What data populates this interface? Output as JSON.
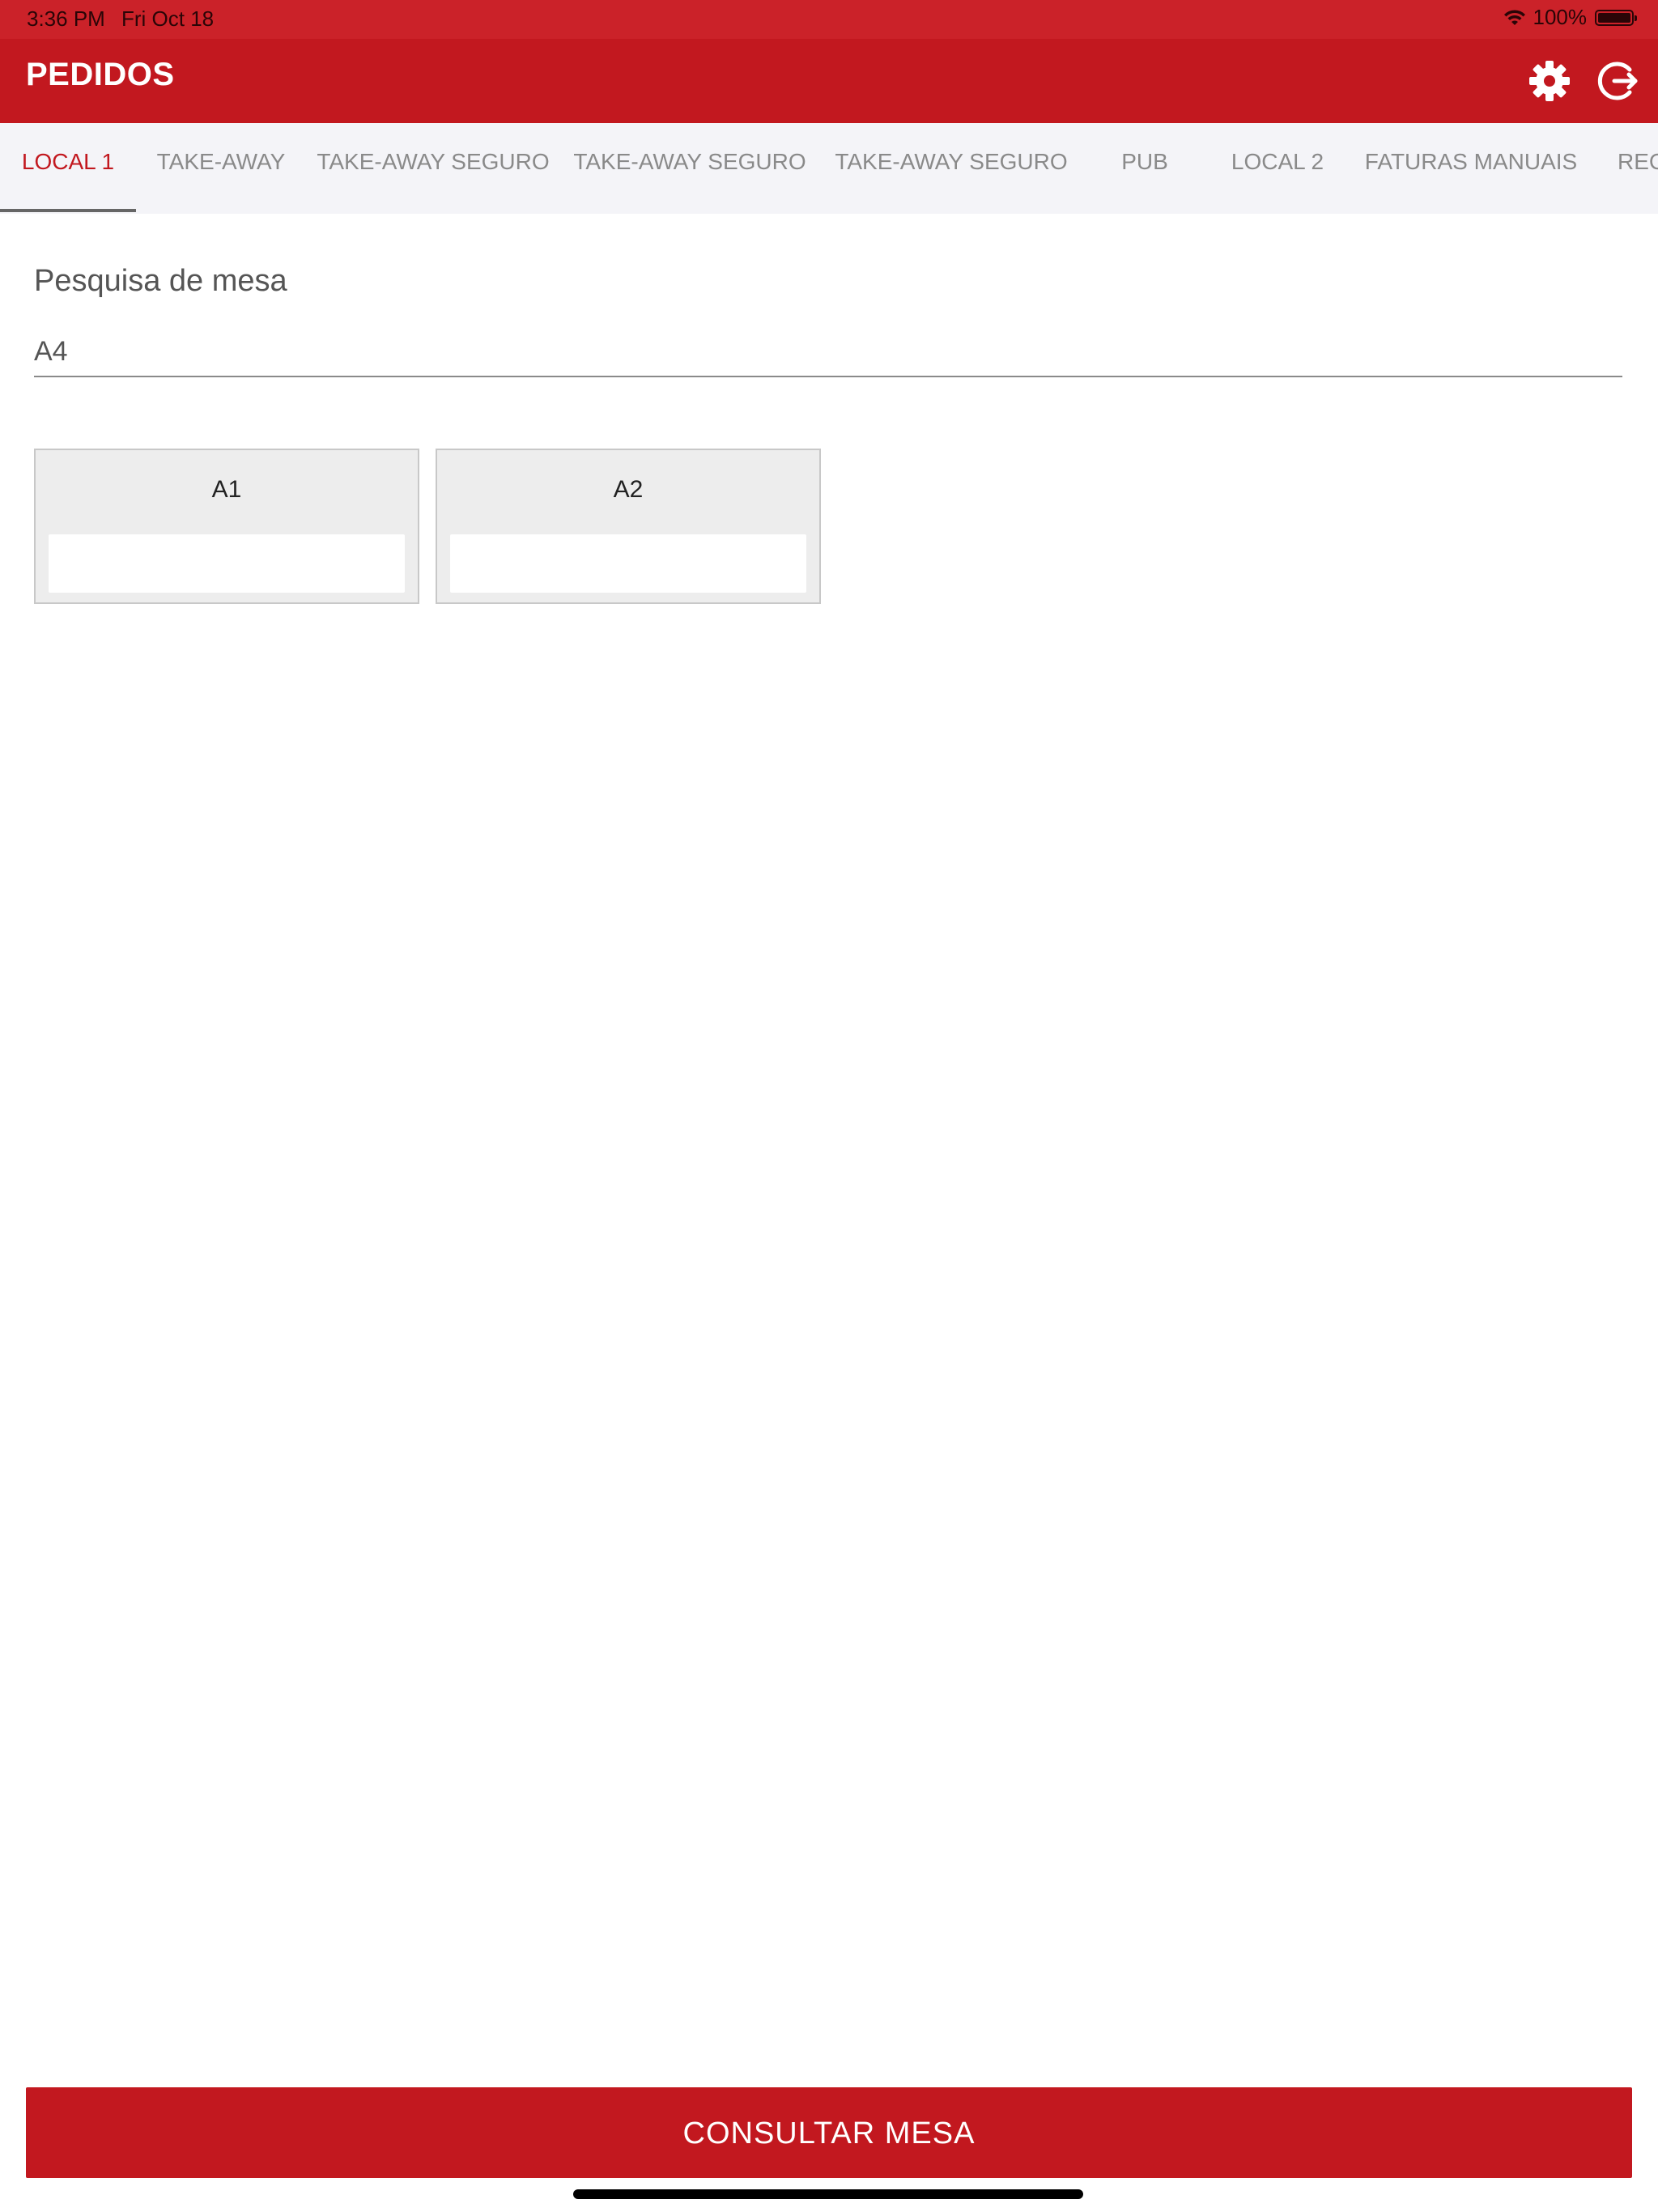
{
  "status_bar": {
    "time": "3:36 PM",
    "date": "Fri Oct 18",
    "battery_percent": "100%",
    "battery_level": 1.0,
    "wifi_icon": "wifi-icon"
  },
  "header": {
    "title": "PEDIDOS",
    "settings_icon": "gear-icon",
    "logout_icon": "logout-icon",
    "background": "#c2181f"
  },
  "tabs": [
    {
      "label": "LOCAL 1",
      "active": true
    },
    {
      "label": "TAKE-AWAY",
      "active": false
    },
    {
      "label": "TAKE-AWAY SEGURO",
      "active": false
    },
    {
      "label": "TAKE-AWAY SEGURO",
      "active": false
    },
    {
      "label": "TAKE-AWAY SEGURO",
      "active": false
    },
    {
      "label": "PUB",
      "active": false
    },
    {
      "label": "LOCAL 2",
      "active": false
    },
    {
      "label": "FATURAS MANUAIS",
      "active": false
    },
    {
      "label": "REC",
      "active": false
    }
  ],
  "search": {
    "label": "Pesquisa de mesa",
    "value": "A4"
  },
  "tables": [
    {
      "name": "A1"
    },
    {
      "name": "A2"
    }
  ],
  "actions": {
    "consult_label": "CONSULTAR MESA"
  },
  "colors": {
    "accent": "#c2181f",
    "status_bar": "#cb2229",
    "tab_bar": "#f4f4f8",
    "card": "#ededed"
  }
}
